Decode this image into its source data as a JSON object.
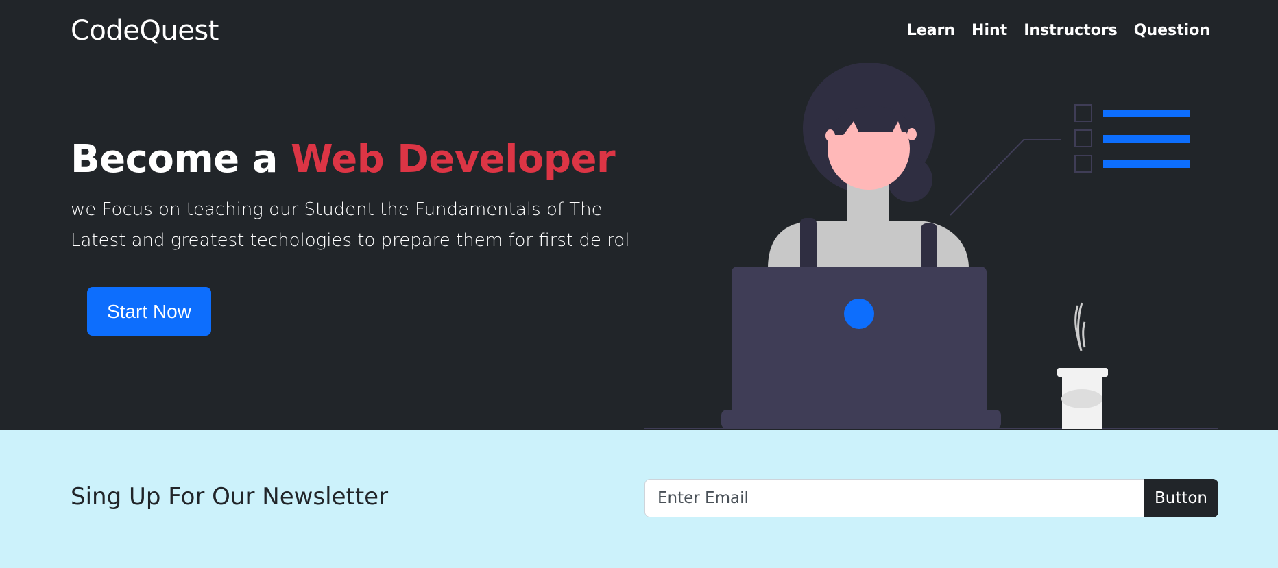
{
  "brand": "CodeQuest",
  "nav": {
    "items": [
      "Learn",
      "Hint",
      "Instructors",
      "Question"
    ]
  },
  "hero": {
    "headline_prefix": "Become a ",
    "headline_accent": "Web Developer",
    "lede": "we Focus on teaching our Student the Fundamentals of The Latest and greatest techologies to prepare them for first de rol",
    "cta_label": "Start Now"
  },
  "newsletter": {
    "title": "Sing Up For Our Newsletter",
    "email_placeholder": "Enter Email",
    "button_label": "Button"
  },
  "colors": {
    "hero_bg": "#212529",
    "accent_red": "#dc3545",
    "primary_blue": "#0d6efd",
    "newsletter_bg": "#ccf2fb"
  },
  "icons": {
    "illustration": "developer-at-laptop-illustration"
  }
}
